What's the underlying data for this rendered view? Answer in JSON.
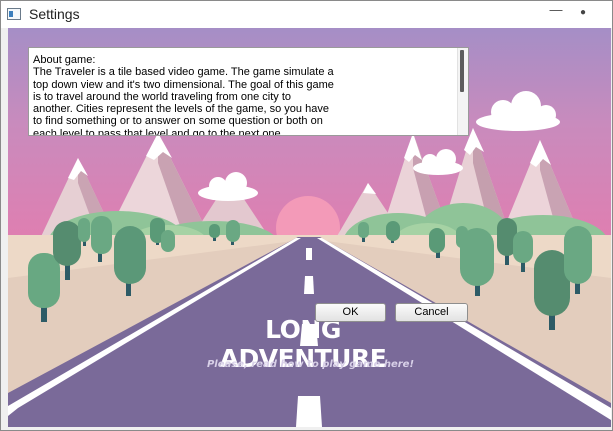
{
  "window": {
    "title": "Settings",
    "minimize_glyph": "—",
    "close_glyph": "●"
  },
  "about": {
    "text": "About game:\n The Traveler is a tile based video game. The game simulate a\n top down view and it's two dimensional. The goal of this game\n is to travel around the world traveling from one city to\n another. Cities represent the levels of the game, so you have\n to find something or to answer on some question or both on\n each level to pass that level and go to the next one."
  },
  "buttons": {
    "ok_label": "OK",
    "cancel_label": "Cancel"
  },
  "background": {
    "title": "LONG ADVENTURE",
    "subtitle": "Please, read how to play game here!"
  },
  "colors": {
    "sky_top": "#a58ec6",
    "sky_pink": "#d983b5",
    "sun": "#f39ab8",
    "road": "#7a6a99",
    "ground": "#edd9c7",
    "tree_green": "#5b9878",
    "tree_trunk": "#2d5b66"
  }
}
